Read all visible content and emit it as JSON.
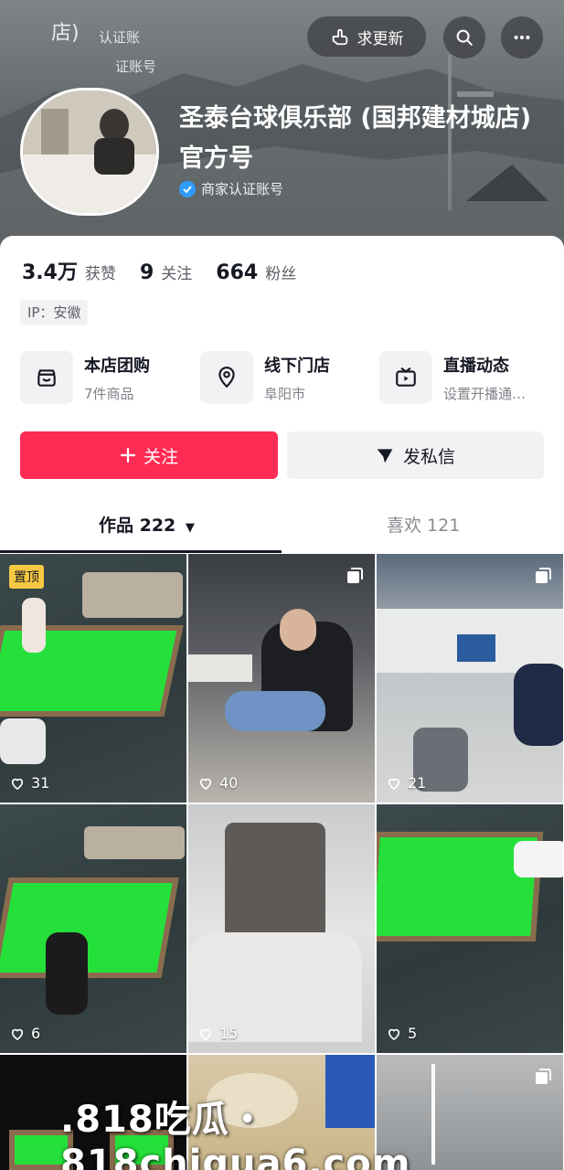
{
  "header": {
    "update_button": "求更新",
    "ghost_top_left": "店)",
    "ghost_badge_1": "认证账",
    "ghost_badge_2": "证账号",
    "profile_name": "圣泰台球俱乐部 (国邦建材城店) 官方号",
    "verify_label": "商家认证账号"
  },
  "stats": [
    {
      "value": "3.4万",
      "label": "获赞"
    },
    {
      "value": "9",
      "label": "关注"
    },
    {
      "value": "664",
      "label": "粉丝"
    }
  ],
  "ip_label": "IP：安徽",
  "services": [
    {
      "title": "本店团购",
      "sub": "7件商品",
      "icon": "shop-icon"
    },
    {
      "title": "线下门店",
      "sub": "阜阳市",
      "icon": "location-pin-icon"
    },
    {
      "title": "直播动态",
      "sub": "设置开播通…",
      "icon": "live-tv-icon"
    }
  ],
  "actions": {
    "follow": "关注",
    "message": "发私信"
  },
  "tabs": {
    "works": "作品 222",
    "likes": "喜欢 121"
  },
  "videos": [
    {
      "likes": "31",
      "pinned": "置顶"
    },
    {
      "likes": "40"
    },
    {
      "likes": "21"
    },
    {
      "likes": "6"
    },
    {
      "likes": "15"
    },
    {
      "likes": "5"
    }
  ],
  "watermark": ".818吃瓜・818chigua6.com",
  "colors": {
    "accent": "#fe2c55",
    "verify": "#2f9bff",
    "pinned": "#f7c843"
  }
}
